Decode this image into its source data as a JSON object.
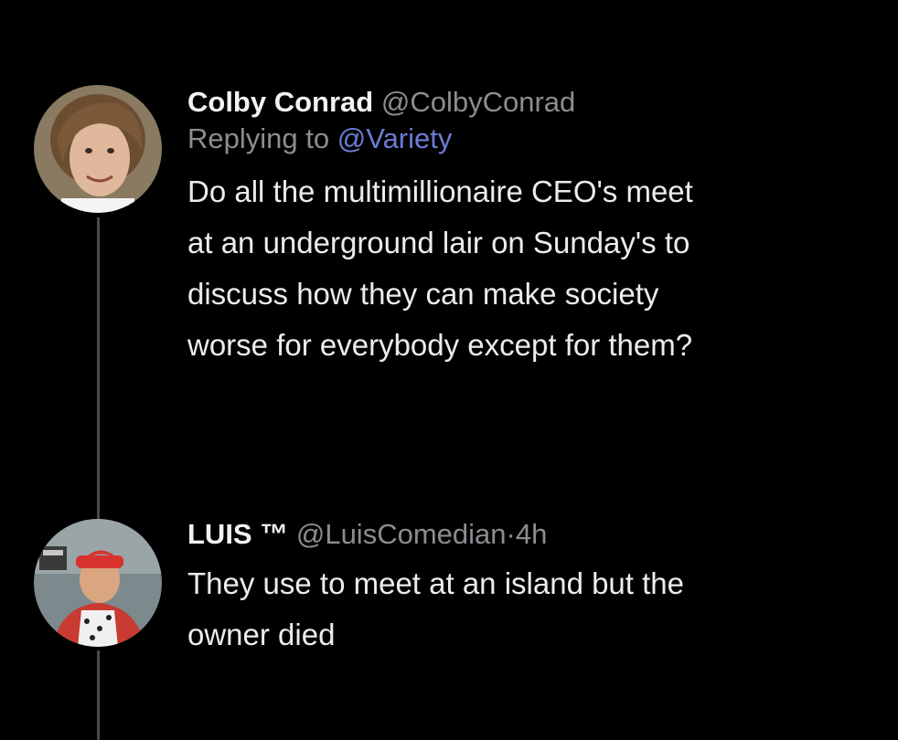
{
  "thread": {
    "tweets": [
      {
        "display_name": "Colby Conrad",
        "handle": "@ColbyConrad",
        "replying_prefix": "Replying to ",
        "replying_to": "@Variety",
        "text_lines": [
          "Do all the multimillionaire CEO's meet",
          "at an underground lair on Sunday's to",
          "discuss how they can make society",
          "worse for everybody except for them?"
        ]
      },
      {
        "display_name": "LUIS ™",
        "handle": "@LuisComedian",
        "separator": "·",
        "timestamp": "4h",
        "text_lines": [
          "They use to meet at an island but the",
          "owner died"
        ]
      }
    ]
  },
  "colors": {
    "background": "#000000",
    "text": "#ececec",
    "muted": "#8a8d91",
    "mention": "#6b7bd6",
    "thread_line": "#4a4a4a"
  }
}
